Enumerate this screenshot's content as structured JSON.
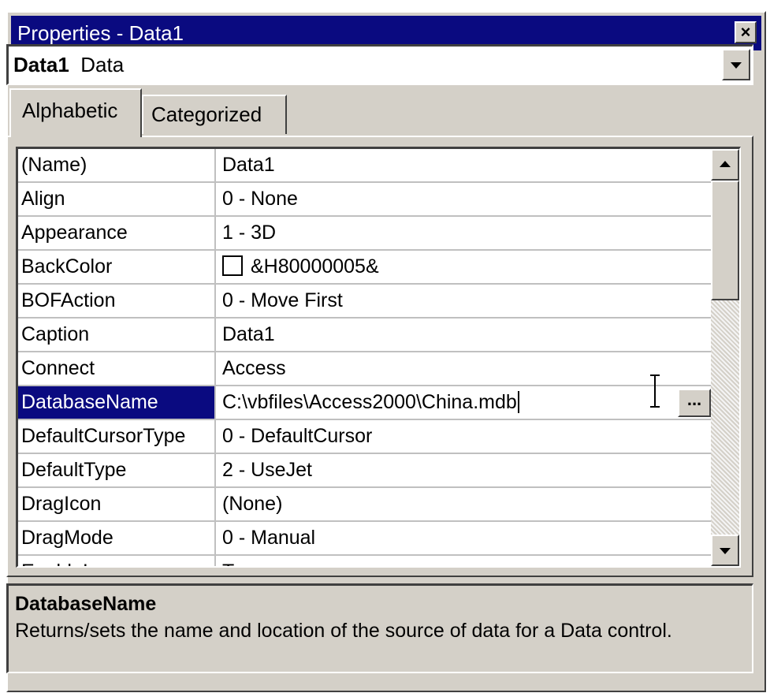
{
  "window": {
    "title": "Properties - Data1",
    "close_icon": "close-icon"
  },
  "object_selector": {
    "object_name": "Data1",
    "object_type": "Data"
  },
  "tabs": [
    {
      "label": "Alphabetic",
      "active": true
    },
    {
      "label": "Categorized",
      "active": false
    }
  ],
  "properties": [
    {
      "name": "(Name)",
      "value": "Data1"
    },
    {
      "name": "Align",
      "value": "0 - None"
    },
    {
      "name": "Appearance",
      "value": "1 - 3D"
    },
    {
      "name": "BackColor",
      "value": "&H80000005&"
    },
    {
      "name": "BOFAction",
      "value": "0 - Move First"
    },
    {
      "name": "Caption",
      "value": "Data1"
    },
    {
      "name": "Connect",
      "value": "Access"
    },
    {
      "name": "DatabaseName",
      "value": "C:\\vbfiles\\Access2000\\China.mdb",
      "selected": true
    },
    {
      "name": "DefaultCursorType",
      "value": "0 - DefaultCursor"
    },
    {
      "name": "DefaultType",
      "value": "2 - UseJet"
    },
    {
      "name": "DragIcon",
      "value": "(None)"
    },
    {
      "name": "DragMode",
      "value": "0 - Manual"
    },
    {
      "name": "EnableI",
      "value": "T"
    }
  ],
  "ellipsis_button": {
    "label": "..."
  },
  "description": {
    "title": "DatabaseName",
    "text": "Returns/sets the name and location of the source of data for a Data control."
  },
  "colors": {
    "title_bar": "#0a0a80",
    "selection": "#0a0a80",
    "face": "#d4d0c8"
  }
}
